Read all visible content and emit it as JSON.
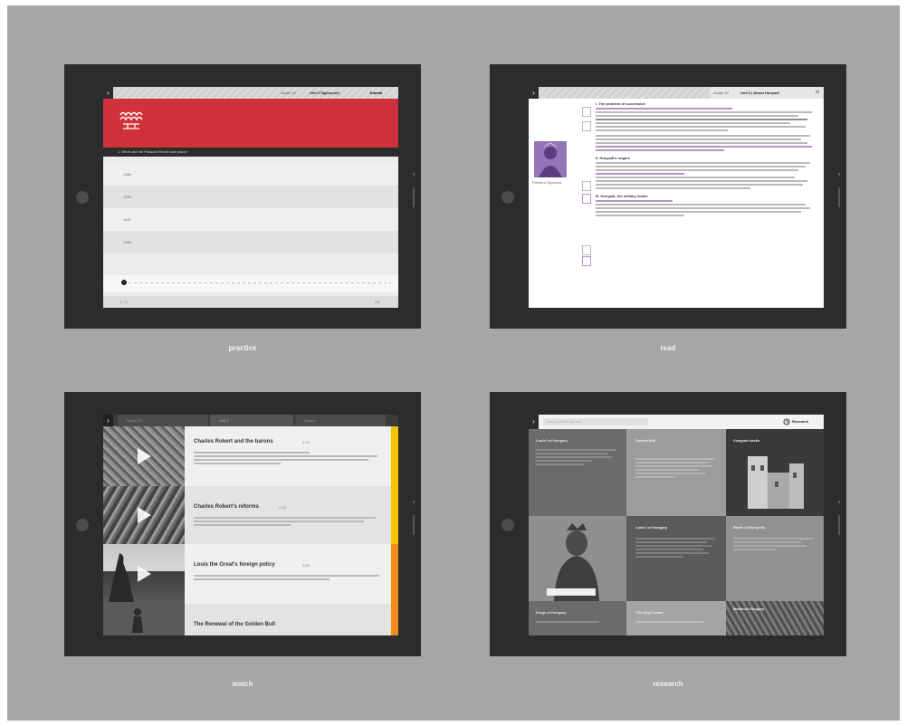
{
  "captions": {
    "practice": "practice",
    "read": "read",
    "watch": "watch",
    "research": "research"
  },
  "colors": {
    "background": "#a5a7a7",
    "tablet": "#2b2c2d",
    "accent_red": "#d0313a",
    "highlight_purple": "#b594c8",
    "video_yellow": "#f2c400",
    "video_orange": "#f08c17"
  },
  "practice": {
    "breadcrumb": "Grade 10",
    "unit": "Unit 3 Sigismund",
    "mode": "Tutorial",
    "question": "1. When did the Peasant Revolt take place?",
    "answers": [
      "1386",
      "1433",
      "1437",
      "1396"
    ],
    "progress": 0.05,
    "footer_left": "1 / 17",
    "footer_right": "0%"
  },
  "read": {
    "breadcrumb": "Grade 10",
    "unit": "Unit 3 | About Hunyadi",
    "image_caption": "Portrait of Sigismund",
    "sections": [
      "I. The problem of succession",
      "II. Hunyadi's origins",
      "III. Hunyadi, the military leader"
    ]
  },
  "watch": {
    "tabs": [
      "Grade 10",
      "Unit 3",
      "Search"
    ],
    "videos": [
      {
        "title": "Charles Robert and the barons",
        "duration": "5:12",
        "accent": "#f2c400"
      },
      {
        "title": "Charles Robert's reforms",
        "duration": "4:46",
        "accent": "#f2c400"
      },
      {
        "title": "Louis the Great's foreign policy",
        "duration": "3:58",
        "accent": "#f08c17"
      },
      {
        "title": "The Renewal of the Golden Bull",
        "duration": "",
        "accent": "#f08c17"
      }
    ]
  },
  "research": {
    "search_placeholder": "search within this unit",
    "mode": "Research",
    "tiles": [
      "Louis I of Hungary",
      "Golden Bull",
      "Visegrád castle",
      "Louis I of Hungary",
      "Battle of Nicopolis",
      "Kings of Hungary",
      "The Holy Crown",
      "Medieval Hungary"
    ]
  }
}
